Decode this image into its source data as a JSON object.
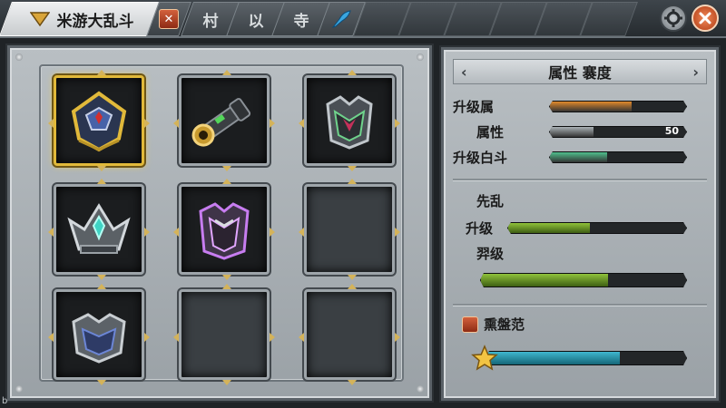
{
  "tabs": [
    {
      "label": "米游大乱斗",
      "icon": "chevron-down-icon",
      "active": true
    },
    {
      "label": "",
      "icon": "scroll-icon",
      "active": false
    },
    {
      "label": "村",
      "active": false
    },
    {
      "label": "以",
      "active": false
    },
    {
      "label": "寺",
      "active": false
    },
    {
      "label": "",
      "icon": "blue-feather-icon",
      "active": false
    }
  ],
  "top_buttons": {
    "settings_icon": "gear-icon",
    "close_icon": "close-icon"
  },
  "inventory": {
    "slots": [
      {
        "item": "dark-helmet-gold",
        "selected": true
      },
      {
        "item": "gold-cannon",
        "selected": false
      },
      {
        "item": "green-armor",
        "selected": false
      },
      {
        "item": "teal-crown",
        "selected": false
      },
      {
        "item": "purple-armor",
        "selected": false
      },
      {
        "item": "",
        "selected": false
      },
      {
        "item": "blue-armor",
        "selected": false
      },
      {
        "item": "",
        "selected": false
      },
      {
        "item": "",
        "selected": false
      }
    ]
  },
  "detail": {
    "header": {
      "title": "属性 褰度",
      "left_arrow": "‹",
      "right_arrow": "›"
    },
    "stats": [
      {
        "label": "升级属",
        "fill": 0.6,
        "color": "#e28a2b"
      },
      {
        "label": "属性",
        "fill": 0.32,
        "color": "#aab2b6",
        "value": "50"
      },
      {
        "label": "升级白斗",
        "fill": 0.42,
        "color": "#4fbf8d"
      }
    ],
    "section2": {
      "heading": "先乱",
      "row1_label": "升级",
      "row1_fill": 0.46,
      "row2_label": "羿级",
      "row2_fill": 0.62,
      "bar_color": "#8fc13a"
    },
    "footer": {
      "label": "熏盤范",
      "fill": 0.67,
      "bar_color": "#3fb7cf",
      "star_icon": "gold-star-icon"
    }
  },
  "colors": {
    "gold": "#e1b93a",
    "frame": "#9ea5aa",
    "panel": "#b9bfc3"
  }
}
